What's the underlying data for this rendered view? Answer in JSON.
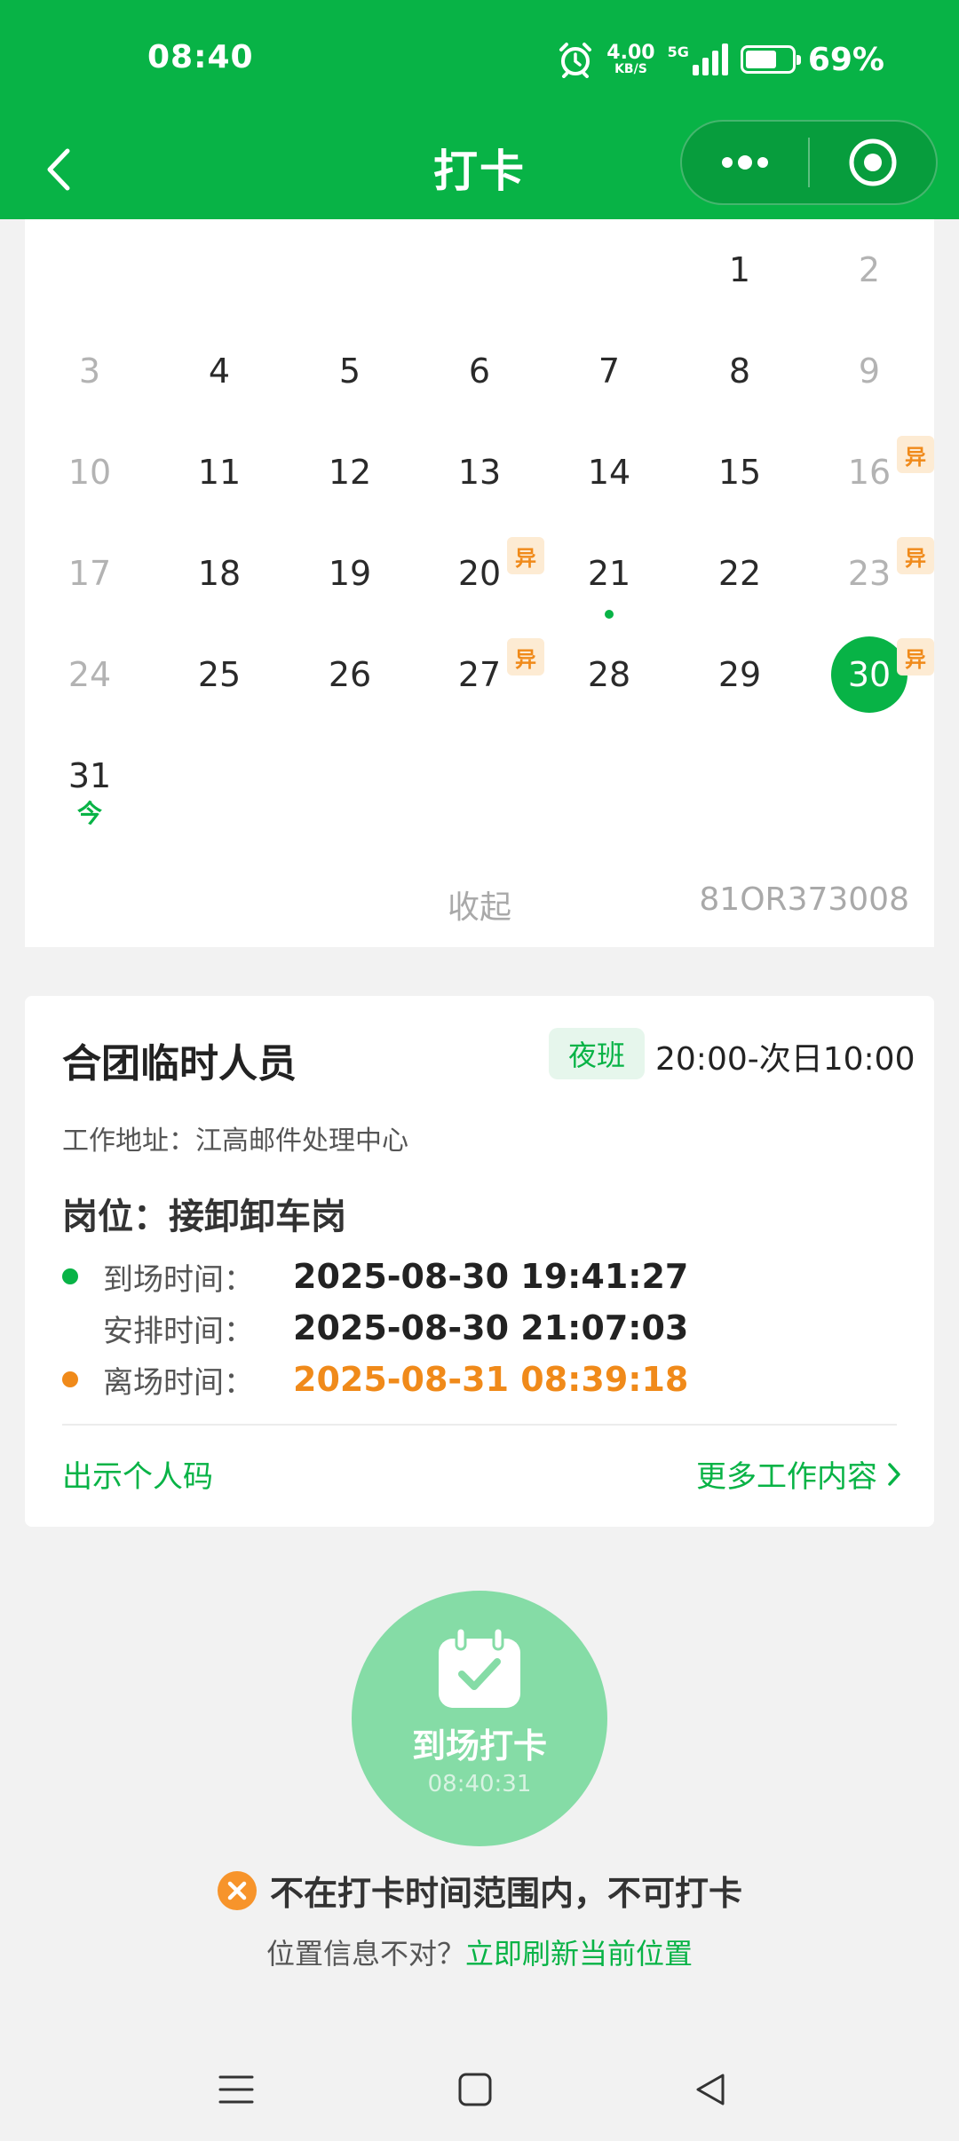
{
  "status_bar": {
    "time": "08:40",
    "net_speed_value": "4.00",
    "net_speed_unit": "KB/S",
    "network_type": "5G",
    "battery_percent": "69%",
    "battery_level": 0.69
  },
  "nav": {
    "title": "打卡",
    "back_icon": "chevron-left-icon",
    "more_icon": "more-dots-icon",
    "close_icon": "target-circle-icon"
  },
  "calendar": {
    "days": [
      {
        "d": "1",
        "muted": false
      },
      {
        "d": "2",
        "muted": true
      },
      {
        "d": "3",
        "muted": true
      },
      {
        "d": "4",
        "muted": false
      },
      {
        "d": "5",
        "muted": false
      },
      {
        "d": "6",
        "muted": false
      },
      {
        "d": "7",
        "muted": false
      },
      {
        "d": "8",
        "muted": false
      },
      {
        "d": "9",
        "muted": true
      },
      {
        "d": "10",
        "muted": true
      },
      {
        "d": "11",
        "muted": false
      },
      {
        "d": "12",
        "muted": false
      },
      {
        "d": "13",
        "muted": false
      },
      {
        "d": "14",
        "muted": false
      },
      {
        "d": "15",
        "muted": false
      },
      {
        "d": "16",
        "muted": true,
        "badge": "异"
      },
      {
        "d": "17",
        "muted": true
      },
      {
        "d": "18",
        "muted": false
      },
      {
        "d": "19",
        "muted": false
      },
      {
        "d": "20",
        "muted": false,
        "badge": "异"
      },
      {
        "d": "21",
        "muted": false,
        "dot": true
      },
      {
        "d": "22",
        "muted": false
      },
      {
        "d": "23",
        "muted": true,
        "badge": "异"
      },
      {
        "d": "24",
        "muted": true
      },
      {
        "d": "25",
        "muted": false
      },
      {
        "d": "26",
        "muted": false
      },
      {
        "d": "27",
        "muted": false,
        "badge": "异"
      },
      {
        "d": "28",
        "muted": false
      },
      {
        "d": "29",
        "muted": false
      },
      {
        "d": "30",
        "muted": false,
        "selected": true,
        "badge": "异"
      },
      {
        "d": "31",
        "muted": false,
        "today": "今"
      }
    ],
    "collapse_label": "收起",
    "code": "81OR373008"
  },
  "shift": {
    "title": "合团临时人员",
    "tag": "夜班",
    "time_range": "20:00-次日10:00",
    "work_address": "工作地址：江高邮件处理中心",
    "post": "岗位：接卸卸车岗",
    "arrive_label": "到场时间：",
    "arrive_value": "2025-08-30 19:41:27",
    "schedule_label": "安排时间：",
    "schedule_value": "2025-08-30 21:07:03",
    "leave_label": "离场时间：",
    "leave_value": "2025-08-31 08:39:18",
    "show_code_label": "出示个人码",
    "more_work_label": "更多工作内容"
  },
  "punch": {
    "label": "到场打卡",
    "time": "08:40:31",
    "warning": "不在打卡时间范围内，不可打卡",
    "location_question": "位置信息不对？",
    "location_action": "立即刷新当前位置"
  },
  "colors": {
    "brand_green": "#08b346",
    "punch_green": "#85dca6",
    "warning_orange": "#f08a1a",
    "badge_bg": "#fdebd3"
  }
}
